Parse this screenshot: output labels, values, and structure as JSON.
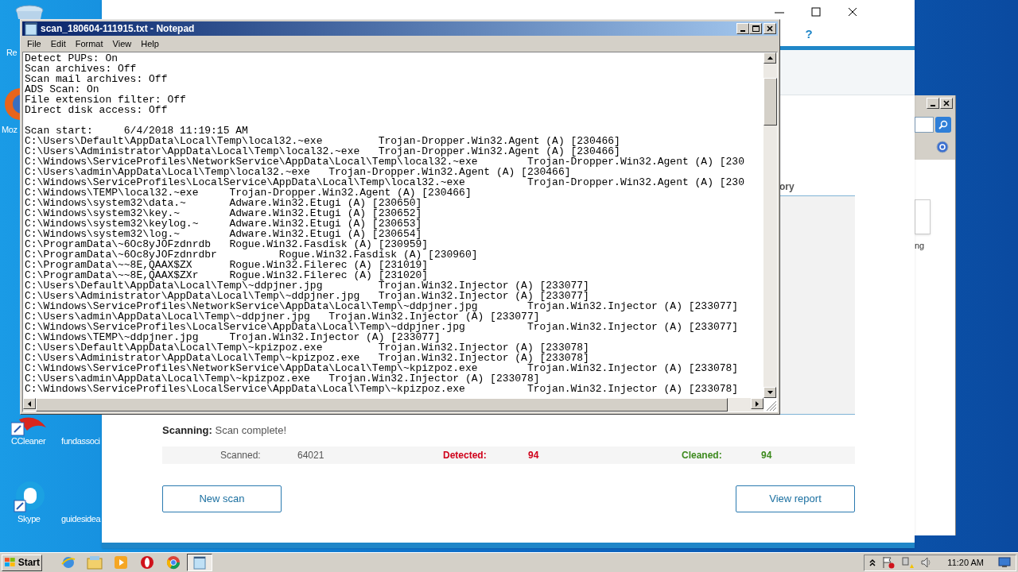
{
  "desktop_icons": [
    {
      "label": "Re",
      "kind": "bin"
    },
    {
      "label": "Moz",
      "kind": "globe"
    },
    {
      "label": "CCleaner",
      "kind": "cleaner"
    },
    {
      "label": "fundassoci",
      "kind": "none"
    },
    {
      "label": "Skype",
      "kind": "chat"
    },
    {
      "label": "guidesidea",
      "kind": "none"
    }
  ],
  "side_window": {
    "text": "ng"
  },
  "scanner_window": {
    "help": "?",
    "column_fragment": "ory",
    "status_label": "Scanning:",
    "status": "Scan complete!",
    "stats": [
      {
        "label": "Scanned:",
        "value": "64021",
        "kind": "neutral"
      },
      {
        "label": "Detected:",
        "value": "94",
        "kind": "danger"
      },
      {
        "label": "Cleaned:",
        "value": "94",
        "kind": "success"
      }
    ],
    "buttons": [
      "New scan",
      "View report"
    ]
  },
  "notepad": {
    "title": "scan_180604-111915.txt - Notepad",
    "menu": [
      "File",
      "Edit",
      "Format",
      "View",
      "Help"
    ],
    "settings": [
      "Detect PUPs: On",
      "Scan archives: Off",
      "Scan mail archives: Off",
      "ADS Scan: On",
      "File extension filter: Off",
      "Direct disk access: Off"
    ],
    "log": [
      "Scan start:     6/4/2018 11:19:15 AM",
      "C:\\Users\\Default\\AppData\\Local\\Temp\\local32.~exe         Trojan-Dropper.Win32.Agent (A) [230466]",
      "C:\\Users\\Administrator\\AppData\\Local\\Temp\\local32.~exe   Trojan-Dropper.Win32.Agent (A) [230466]",
      "C:\\Windows\\ServiceProfiles\\NetworkService\\AppData\\Local\\Temp\\local32.~exe        Trojan-Dropper.Win32.Agent (A) [230",
      "C:\\Users\\admin\\AppData\\Local\\Temp\\local32.~exe   Trojan-Dropper.Win32.Agent (A) [230466]",
      "C:\\Windows\\ServiceProfiles\\LocalService\\AppData\\Local\\Temp\\local32.~exe          Trojan-Dropper.Win32.Agent (A) [230",
      "C:\\Windows\\TEMP\\local32.~exe     Trojan-Dropper.Win32.Agent (A) [230466]",
      "C:\\Windows\\system32\\data.~       Adware.Win32.Etugi (A) [230650]",
      "C:\\Windows\\system32\\key.~        Adware.Win32.Etugi (A) [230652]",
      "C:\\Windows\\system32\\keylog.~     Adware.Win32.Etugi (A) [230653]",
      "C:\\Windows\\system32\\log.~        Adware.Win32.Etugi (A) [230654]",
      "C:\\ProgramData\\~6Oc8yJOFzdnrdb   Rogue.Win32.Fasdisk (A) [230959]",
      "C:\\ProgramData\\~6Oc8yJOFzdnrdbr          Rogue.Win32.Fasdisk (A) [230960]",
      "C:\\ProgramData\\~~8E,QAAX$ZX      Rogue.Win32.Filerec (A) [231019]",
      "C:\\ProgramData\\~~8E,QAAX$ZXr     Rogue.Win32.Filerec (A) [231020]",
      "C:\\Users\\Default\\AppData\\Local\\Temp\\~ddpjner.jpg         Trojan.Win32.Injector (A) [233077]",
      "C:\\Users\\Administrator\\AppData\\Local\\Temp\\~ddpjner.jpg   Trojan.Win32.Injector (A) [233077]",
      "C:\\Windows\\ServiceProfiles\\NetworkService\\AppData\\Local\\Temp\\~ddpjner.jpg        Trojan.Win32.Injector (A) [233077]",
      "C:\\Users\\admin\\AppData\\Local\\Temp\\~ddpjner.jpg   Trojan.Win32.Injector (A) [233077]",
      "C:\\Windows\\ServiceProfiles\\LocalService\\AppData\\Local\\Temp\\~ddpjner.jpg          Trojan.Win32.Injector (A) [233077]",
      "C:\\Windows\\TEMP\\~ddpjner.jpg     Trojan.Win32.Injector (A) [233077]",
      "C:\\Users\\Default\\AppData\\Local\\Temp\\~kpizpoz.exe         Trojan.Win32.Injector (A) [233078]",
      "C:\\Users\\Administrator\\AppData\\Local\\Temp\\~kpizpoz.exe   Trojan.Win32.Injector (A) [233078]",
      "C:\\Windows\\ServiceProfiles\\NetworkService\\AppData\\Local\\Temp\\~kpizpoz.exe        Trojan.Win32.Injector (A) [233078]",
      "C:\\Users\\admin\\AppData\\Local\\Temp\\~kpizpoz.exe   Trojan.Win32.Injector (A) [233078]",
      "C:\\Windows\\ServiceProfiles\\LocalService\\AppData\\Local\\Temp\\~kpizpoz.exe          Trojan.Win32.Injector (A) [233078]"
    ]
  },
  "taskbar": {
    "start": "Start",
    "items": [
      {
        "kind": "browser",
        "selected": false
      },
      {
        "kind": "folder",
        "selected": false
      },
      {
        "kind": "media",
        "selected": false
      },
      {
        "kind": "ring",
        "selected": false
      },
      {
        "kind": "globe",
        "selected": false
      },
      {
        "kind": "notepad",
        "selected": true
      }
    ],
    "clock": "11:20 AM"
  }
}
